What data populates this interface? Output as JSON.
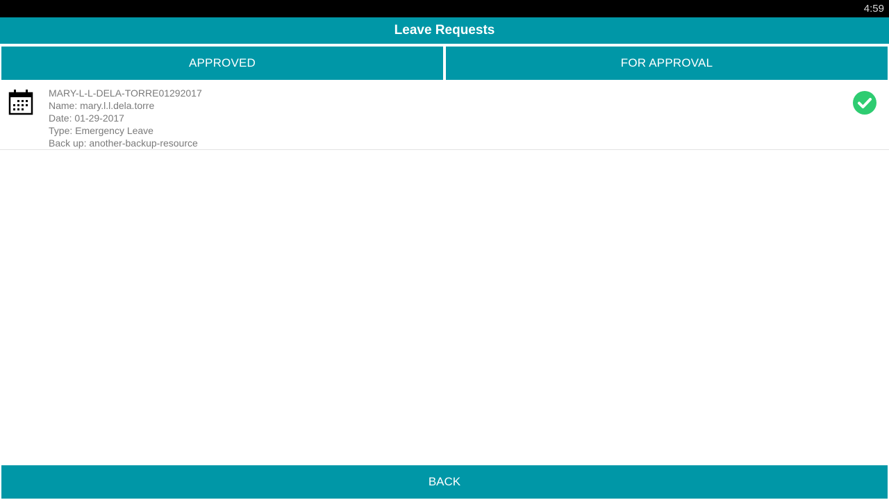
{
  "status_bar": {
    "time": "4:59"
  },
  "header": {
    "title": "Leave Requests"
  },
  "tabs": [
    {
      "label": "APPROVED"
    },
    {
      "label": "FOR APPROVAL"
    }
  ],
  "requests": [
    {
      "id": "MARY-L-L-DELA-TORRE01292017",
      "name": "Name: mary.l.l.dela.torre",
      "date": "Date: 01-29-2017",
      "type": "Type: Emergency Leave",
      "backup": "Back up: another-backup-resource",
      "icon": "calendar-icon",
      "status_icon": "check-circle-icon"
    }
  ],
  "footer": {
    "back_label": "BACK"
  },
  "colors": {
    "accent": "#0097a7",
    "status_bar": "#000000",
    "success": "#2ecc71",
    "secondary_text": "#7a7a7a"
  }
}
